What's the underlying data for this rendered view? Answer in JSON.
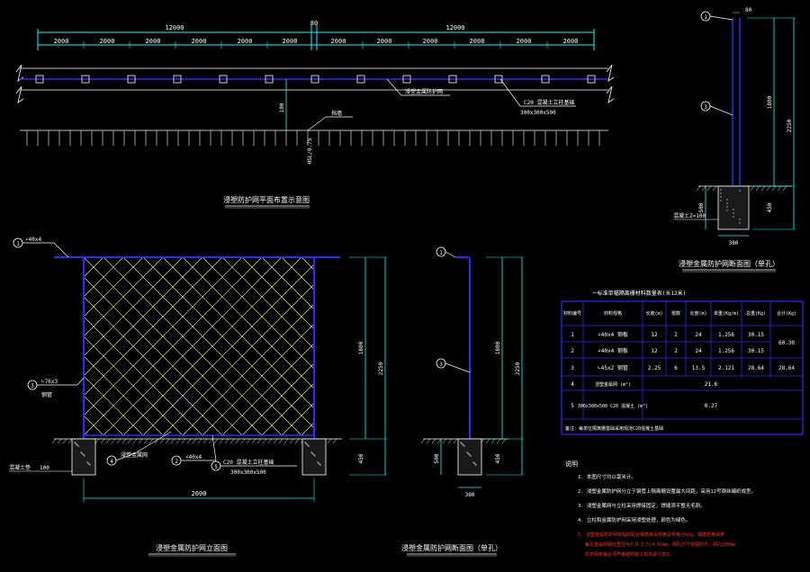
{
  "colors": {
    "background": "#000000",
    "dimension": "#00ffff",
    "structure": "#2a2aff",
    "mesh": "#ffff80",
    "text": "#ffffff",
    "note_warning": "#ff3030",
    "ground": "#ffffff"
  },
  "plan": {
    "total_left": "12000",
    "total_right": "12000",
    "gap": "80",
    "segments": [
      "2000",
      "2000",
      "2000",
      "2000",
      "2000",
      "2000",
      "2000",
      "2000",
      "2000",
      "2008",
      "2000",
      "2000"
    ],
    "dim_100": "100",
    "label_mesh": "浸塑金属防护网",
    "label_concrete": "C20 混凝土立柱基础",
    "label_concrete_size": "300x300x500",
    "label_wall": "挡墙",
    "label_post": "HSL/0.75",
    "title": "浸塑防护网平面布置示意图"
  },
  "elevation": {
    "callout_1": "1",
    "label_1": "∠40x4",
    "callout_3": "3",
    "label_3a": "∟76x3",
    "label_3b": "钢管",
    "callout_4": "4",
    "label_4": "浸塑金属网",
    "callout_2": "2",
    "label_2": "∠40x4",
    "callout_5": "5",
    "label_5a": "C20 混凝土立柱基础",
    "label_5b": "300x300x500",
    "label_ground": "混凝土垫",
    "label_ground_dim": "100",
    "dim_width": "2000",
    "dim_1800": "1800",
    "dim_2250": "2250",
    "dim_450": "450",
    "title": "浸塑金属防护网立面图"
  },
  "side_section": {
    "callout_1": "1",
    "callout_3": "3",
    "dim_1800": "1800",
    "dim_2250": "2250",
    "dim_500": "500",
    "dim_450": "450",
    "dim_380": "380",
    "title": "浸塑金属防护网断面图（单孔）"
  },
  "top_section": {
    "callout_1": "1",
    "callout_3": "3",
    "dim_80": "80",
    "dim_1800": "1800",
    "dim_2250": "2250",
    "dim_500": "500",
    "dim_450": "450",
    "dim_380": "380",
    "label_ground": "混凝土Z=100",
    "title": "浸塑金属防护网断面图（单孔）"
  },
  "table": {
    "title": "一标准单幅隔离栅材料数量表(长12米)",
    "headers": [
      "材料编号",
      "材料规格",
      "长度(m)",
      "根数",
      "长度(m)",
      "单重(Kg/m)",
      "总重(Kg)",
      "合计(Kg)"
    ],
    "rows": [
      [
        "1",
        "∠40x4 钢板",
        "12",
        "2",
        "24",
        "1.256",
        "30.15",
        "60.30"
      ],
      [
        "2",
        "∠40x4 钢板",
        "12",
        "2",
        "24",
        "1.256",
        "30.15",
        ""
      ],
      [
        "3",
        "∟45x2 钢管",
        "2.25",
        "6",
        "13.5",
        "2.121",
        "28.64",
        "28.64"
      ],
      [
        "4",
        "浸塑金属网 (m²)",
        "",
        "",
        "",
        "21.6",
        "",
        ""
      ],
      [
        "5",
        "300x300x500 C20 混凝土 (m³)",
        "",
        "",
        "",
        "0.27",
        "",
        ""
      ]
    ],
    "note": "备注：每单位隔离栅基础采用现浇C20混凝土基础"
  },
  "notes": {
    "heading": "说明",
    "items": [
      "1. 本图尺寸均以毫米计。",
      "2. 浸塑金属防护网分立于钢管上隔离栅设置最大间距，采用12号钢丝编织成型。",
      "3. 浸塑金属网与立柱采用焊接固定，焊缝须平整无毛刺。",
      "4. 立柱和金属防护网采用浸塑处理，颜色为绿色。"
    ],
    "warning_items": [
      "5. 浸塑金属防护网单幅的配合钢筋架设规格及规格为5kg，钢筋规格如表",
      "每孔金属网钢丝直径为3.0-3.5(4.0)mm，网孔尺寸如图所示，网孔100mm",
      "防护网安装必须严格按照施工规范进行施工。"
    ]
  }
}
